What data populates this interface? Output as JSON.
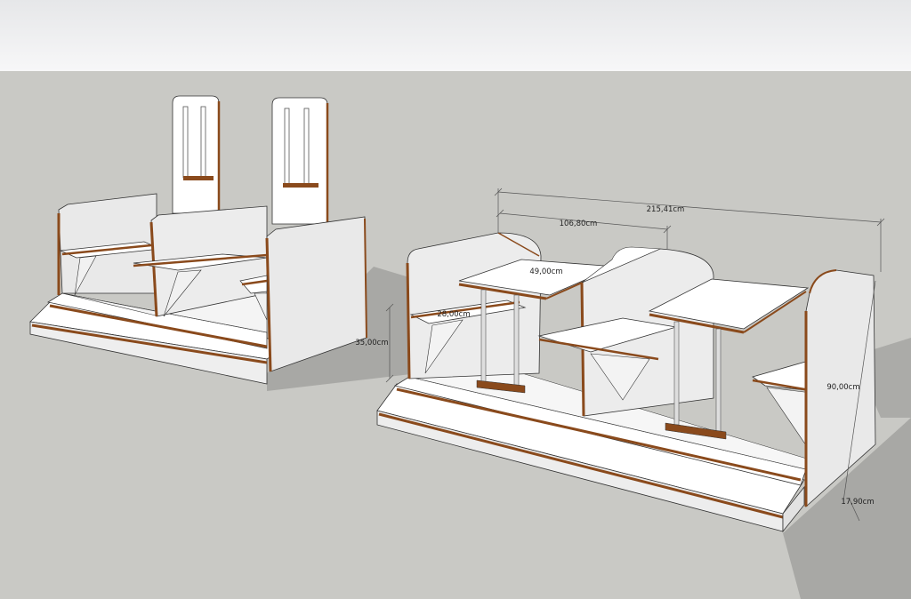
{
  "dimensions": {
    "total_length": "215,41cm",
    "module_length": "106,80cm",
    "table_depth": "49,00cm",
    "seat_depth": "28,00cm",
    "seat_height": "35,00cm",
    "back_height": "90,00cm",
    "step_height": "17,90cm"
  },
  "colors": {
    "sky_top": "#e9eaeb",
    "sky_bottom": "#f6f6f7",
    "ground": "#c9c9c5",
    "panel_face": "#ffffff",
    "panel_side": "#ececec",
    "edge_wood": "#8a4a1c",
    "shadow": "#a5a5a2",
    "pole": "#d9d9d9"
  }
}
